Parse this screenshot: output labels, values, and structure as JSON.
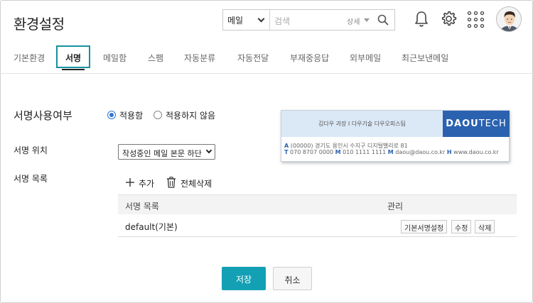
{
  "header": {
    "title": "환경설정",
    "search": {
      "scope": "메일",
      "placeholder": "검색",
      "detail_label": "상세"
    }
  },
  "icons": {
    "search": "search-icon",
    "notifications": "bell-icon",
    "settings": "gear-icon",
    "apps": "apps-grid-icon"
  },
  "tabs": [
    {
      "label": "기본환경"
    },
    {
      "label": "서명"
    },
    {
      "label": "메일함"
    },
    {
      "label": "스팸"
    },
    {
      "label": "자동분류"
    },
    {
      "label": "자동전달"
    },
    {
      "label": "부재중응답"
    },
    {
      "label": "외부메일"
    },
    {
      "label": "최근보낸메일"
    }
  ],
  "signature": {
    "use_label": "서명사용여부",
    "option_apply": "적용함",
    "option_not_apply": "적용하지 않음",
    "position_label": "서명 위치",
    "position_value": "작성중인 메일 본문 하단",
    "list_label": "서명 목록",
    "add_label": "추가",
    "delete_all_label": "전체삭제",
    "table": {
      "col_name": "서명 목록",
      "col_manage": "관리",
      "rows": [
        {
          "name": "default(기본)",
          "actions": [
            "기본서명설정",
            "수정",
            "삭제"
          ]
        }
      ]
    }
  },
  "preview": {
    "name_line": "김다우 과장 I 다우기술 다우오피스팀",
    "logo_part1": "DAOU",
    "logo_part2": "TECH",
    "address_key": "A",
    "address": "(00000) 경기도 용인시 수지구 디지털밸리로 81",
    "phone_key": "T",
    "phone": "070 8707 0000",
    "mobile_key": "M",
    "mobile": "010 1111 1111",
    "mail_key": "M",
    "mail": "daou@daou.co.kr",
    "home_key": "H",
    "home": "www.daou.co.kr"
  },
  "buttons": {
    "save": "저장",
    "cancel": "취소"
  },
  "colors": {
    "accent": "#14a0b4",
    "radio": "#2b75d6",
    "preview_logo_bg": "#2a62b0",
    "preview_header_bg": "#dbe8f6"
  }
}
